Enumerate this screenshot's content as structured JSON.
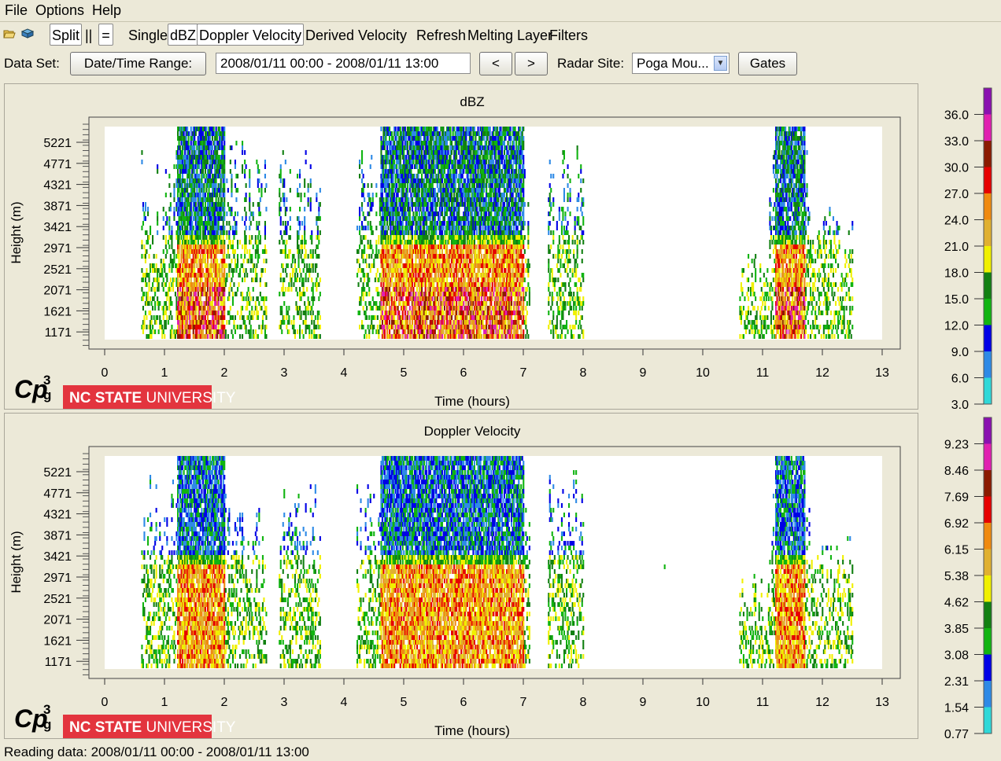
{
  "menu": {
    "file": "File",
    "options": "Options",
    "help": "Help"
  },
  "toolbar": {
    "open_icon": "folder-open-icon",
    "save_icon": "save-icon",
    "split": "Split",
    "parallel": "||",
    "equal": "=",
    "single": "Single",
    "dbz": "dBZ",
    "doppler": "Doppler Velocity",
    "derived": "Derived Velocity",
    "refresh": "Refresh",
    "melting": "Melting Layer",
    "filters": "Filters"
  },
  "dataset": {
    "label": "Data Set:",
    "date_button": "Date/Time Range:",
    "range_value": "2008/01/11 00:00 - 2008/01/11 13:00",
    "prev": "<",
    "next": ">",
    "site_label": "Radar Site:",
    "site_value": "Poga Mou...",
    "gates": "Gates"
  },
  "logo": {
    "cpg": "Cp",
    "cpg_sup": "3",
    "cpg_sub": "g",
    "univ_bold": "NC STATE",
    "univ_rest": " UNIVERSITY"
  },
  "status": "Reading data: 2008/01/11 00:00 - 2008/01/11 13:00",
  "colors": {
    "background": "#ece9d8",
    "scale": [
      "#30d8d8",
      "#2e8ae6",
      "#0000e6",
      "#11b411",
      "#128012",
      "#f0f000",
      "#e0b030",
      "#f08a10",
      "#e60000",
      "#8b1a00",
      "#e020b0",
      "#8a10b0"
    ]
  },
  "chart_data": [
    {
      "type": "heatmap",
      "title": "dBZ",
      "xlabel": "Time (hours)",
      "ylabel": "Height (m)",
      "x_ticks": [
        "0",
        "1",
        "2",
        "3",
        "4",
        "5",
        "6",
        "7",
        "8",
        "9",
        "10",
        "11",
        "12",
        "13"
      ],
      "xlim": [
        0,
        13
      ],
      "y_ticks": [
        "5221",
        "4771",
        "4321",
        "3871",
        "3421",
        "2971",
        "2521",
        "2071",
        "1621",
        "1171"
      ],
      "colorbar": [
        "36.0",
        "33.0",
        "30.0",
        "27.0",
        "24.0",
        "21.0",
        "18.0",
        "15.0",
        "12.0",
        "9.0",
        "6.0",
        "3.0"
      ],
      "echo_periods_hours": [
        [
          0.6,
          2.7
        ],
        [
          2.9,
          3.6
        ],
        [
          4.2,
          4.5
        ],
        [
          4.5,
          7.1
        ],
        [
          7.4,
          8.0
        ],
        [
          10.6,
          11.0
        ],
        [
          11.0,
          12.5
        ]
      ]
    },
    {
      "type": "heatmap",
      "title": "Doppler Velocity",
      "xlabel": "Time (hours)",
      "ylabel": "Height (m)",
      "x_ticks": [
        "0",
        "1",
        "2",
        "3",
        "4",
        "5",
        "6",
        "7",
        "8",
        "9",
        "10",
        "11",
        "12",
        "13"
      ],
      "xlim": [
        0,
        13
      ],
      "y_ticks": [
        "5221",
        "4771",
        "4321",
        "3871",
        "3421",
        "2971",
        "2521",
        "2071",
        "1621",
        "1171"
      ],
      "colorbar": [
        "9.23",
        "8.46",
        "7.69",
        "6.92",
        "6.15",
        "5.38",
        "4.62",
        "3.85",
        "3.08",
        "2.31",
        "1.54",
        "0.77"
      ],
      "echo_periods_hours": [
        [
          0.6,
          2.7
        ],
        [
          2.9,
          3.6
        ],
        [
          4.2,
          4.5
        ],
        [
          4.5,
          7.1
        ],
        [
          7.4,
          8.0
        ],
        [
          10.6,
          11.0
        ],
        [
          11.0,
          12.5
        ]
      ]
    }
  ]
}
